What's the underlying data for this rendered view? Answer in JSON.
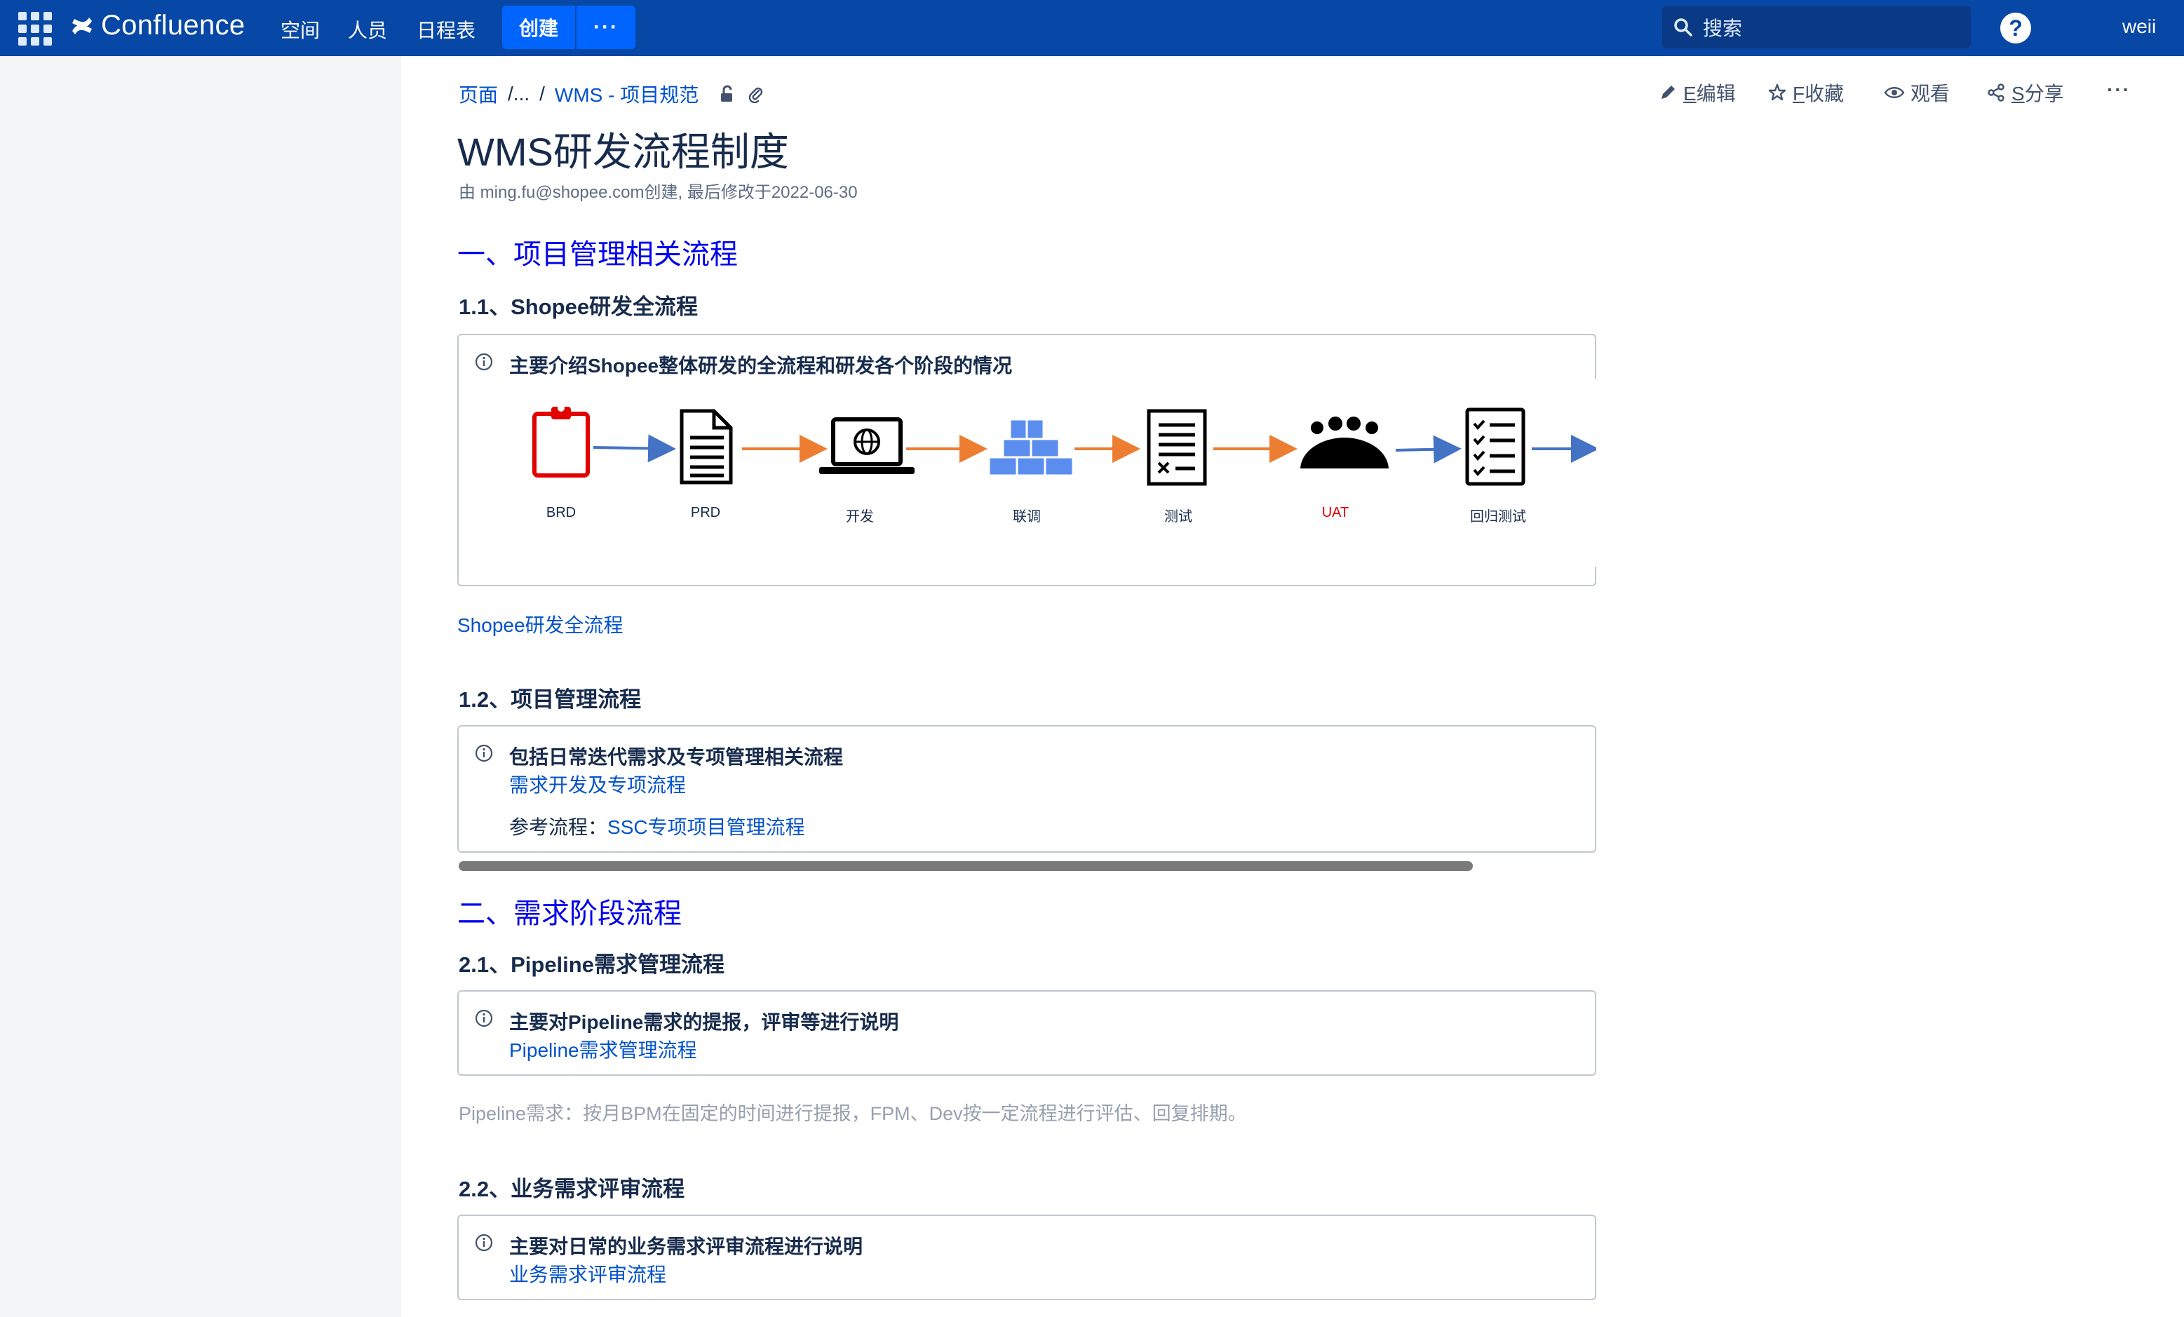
{
  "app": {
    "name": "Confluence"
  },
  "nav": {
    "spaces": "空间",
    "people": "人员",
    "calendar": "日程表",
    "create": "创建",
    "more": "···"
  },
  "search": {
    "placeholder": "搜索"
  },
  "help": "?",
  "user": "weii",
  "breadcrumb": {
    "root": "页面",
    "ellipsis": "/...",
    "sep": "/",
    "parent": "WMS - 项目规范"
  },
  "actions": {
    "edit_key": "E",
    "edit": "编辑",
    "fav_key": "F",
    "fav": "收藏",
    "watch": "观看",
    "share_key": "S",
    "share": "分享",
    "more": "···"
  },
  "page": {
    "title": "WMS研发流程制度",
    "byline": "由 ming.fu@shopee.com创建, 最后修改于2022-06-30"
  },
  "sections": {
    "s1": "一、项目管理相关流程",
    "s1_1": "1.1、Shopee研发全流程",
    "s1_1_panel": "主要介绍Shopee整体研发的全流程和研发各个阶段的情况",
    "s1_1_link": "Shopee研发全流程",
    "s1_2": "1.2、项目管理流程",
    "s1_2_panel": "包括日常迭代需求及专项管理相关流程",
    "s1_2_link": "需求开发及专项流程",
    "s1_2_ref_label": "参考流程：",
    "s1_2_ref_link": "SSC专项项目管理流程",
    "s2": "二、需求阶段流程",
    "s2_1": "2.1、Pipeline需求管理流程",
    "s2_1_panel": "主要对Pipeline需求的提报，评审等进行说明",
    "s2_1_link": "Pipeline需求管理流程",
    "s2_1_note": "Pipeline需求：按月BPM在固定的时间进行提报，FPM、Dev按一定流程进行评估、回复排期。",
    "s2_2": "2.2、业务需求评审流程",
    "s2_2_panel": "主要对日常的业务需求评审流程进行说明",
    "s2_2_link": "业务需求评审流程"
  },
  "flow": {
    "steps": [
      "BRD",
      "PRD",
      "开发",
      "联调",
      "测试",
      "UAT",
      "回归测试"
    ],
    "colors": {
      "red": "#e30000",
      "blue_arrow": "#4472c4",
      "orange_arrow": "#ed7d31",
      "blocks": "#5b8def",
      "uat": "#e30000"
    }
  }
}
